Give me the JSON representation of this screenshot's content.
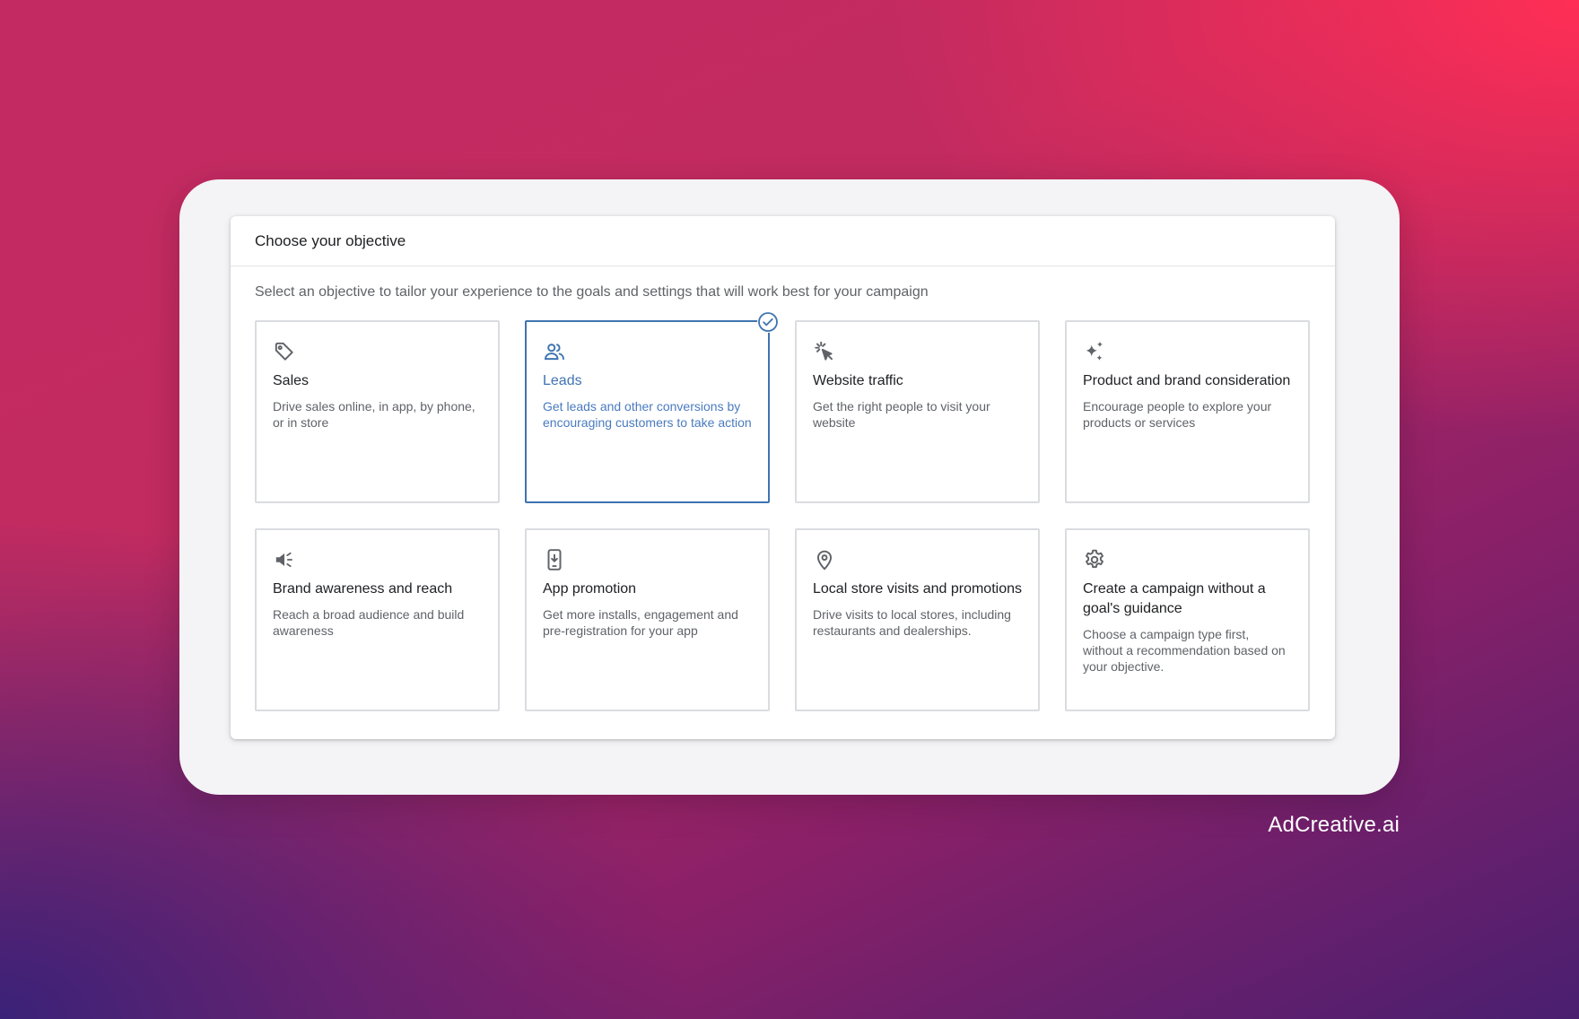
{
  "panel": {
    "title": "Choose your objective",
    "subtitle": "Select an objective to tailor your experience to the goals and settings that will work best for your campaign"
  },
  "objectives": [
    {
      "icon": "tag-icon",
      "title": "Sales",
      "description": "Drive sales online, in app, by phone, or in store",
      "selected": false
    },
    {
      "icon": "people-icon",
      "title": "Leads",
      "description": "Get leads and other conversions by encouraging customers to take action",
      "selected": true
    },
    {
      "icon": "cursor-click-icon",
      "title": "Website traffic",
      "description": "Get the right people to visit your website",
      "selected": false
    },
    {
      "icon": "sparkle-icon",
      "title": "Product and brand consideration",
      "description": "Encourage people to explore your products or services",
      "selected": false
    },
    {
      "icon": "megaphone-icon",
      "title": "Brand awareness and reach",
      "description": "Reach a broad audience and build awareness",
      "selected": false
    },
    {
      "icon": "phone-download-icon",
      "title": "App promotion",
      "description": "Get more installs, engagement and pre-registration for your app",
      "selected": false
    },
    {
      "icon": "location-pin-icon",
      "title": "Local store visits and promotions",
      "description": "Drive visits to local stores, including restaurants and dealerships.",
      "selected": false
    },
    {
      "icon": "gear-icon",
      "title": "Create a campaign without a goal's guidance",
      "description": "Choose a campaign type first, without a recommendation based on your objective.",
      "selected": false
    }
  ],
  "colors": {
    "selected_accent": "#3f74b0",
    "border": "#dadce0",
    "text_primary": "#202124",
    "text_secondary": "#5f6368"
  },
  "watermark": "AdCreative.ai"
}
